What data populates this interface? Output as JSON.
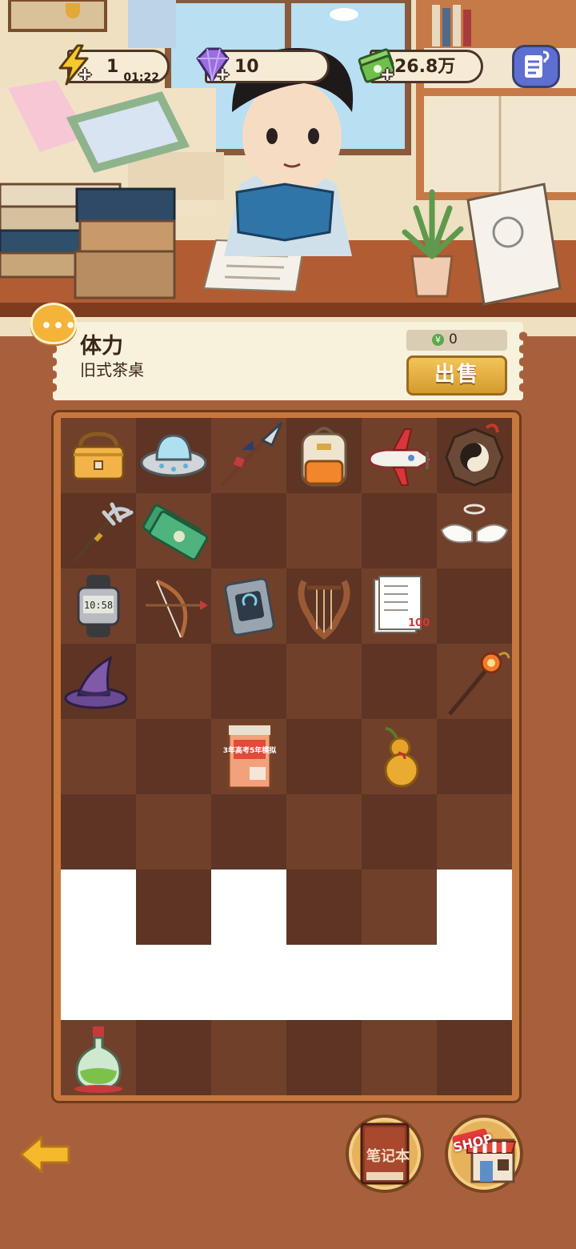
{
  "resources": {
    "energy": {
      "value": "1",
      "timer": "01:22",
      "plus": "+",
      "icon": "lightning-icon"
    },
    "gems": {
      "value": "10",
      "plus": "+",
      "icon": "gem-icon"
    },
    "money": {
      "value": "26.8万",
      "plus": "+",
      "icon": "cash-icon"
    },
    "help_icon": "help-notes-icon"
  },
  "selected_item": {
    "title": "体力",
    "subtitle": "旧式茶桌",
    "price": "0",
    "currency_symbol": "¥",
    "sell_label": "出售",
    "chat_icon": "chat-bubble-icon",
    "chat_dots": "•••"
  },
  "board": {
    "columns": 6,
    "rows": 9,
    "cells": [
      "handbag",
      "ufo",
      "spear",
      "backpack",
      "toy-plane",
      "bagua-compass",
      "trident",
      "cash-bundle",
      "",
      "",
      "",
      "angel-wings",
      "digital-watch",
      "bow-arrow",
      "chip-card",
      "lyre",
      "test-paper",
      "",
      "witch-hat",
      "",
      "",
      "",
      "",
      "magic-staff",
      "",
      "",
      "exam-book",
      "",
      "gourd",
      "",
      "",
      "",
      "",
      "",
      "",
      "",
      "#empty",
      "",
      "#empty",
      "",
      "",
      "#empty",
      "#empty",
      "#empty",
      "#empty",
      "#empty",
      "#empty",
      "#empty",
      "potion-flask",
      "",
      "",
      "",
      "",
      ""
    ],
    "digital_watch_time": "10:58",
    "exam_book_text": "3年高考5年模拟",
    "test_paper_score": "100"
  },
  "bottom": {
    "back_icon": "back-arrow-icon",
    "notebook_label": "笔记本",
    "shop_label": "SHOP"
  }
}
